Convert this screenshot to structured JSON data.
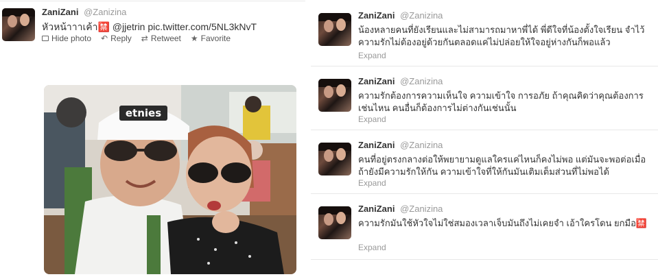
{
  "left_tweet": {
    "name": "ZaniZani",
    "handle": "@Zanizina",
    "text": "หัวหน้าาาเค้า🈲 @jjetrin pic.twitter.com/5NL3kNvT",
    "actions": {
      "hide_photo": "Hide photo",
      "reply": "Reply",
      "retweet": "Retweet",
      "favorite": "Favorite"
    },
    "photo": {
      "cap_text": "etnies"
    }
  },
  "right_tweets": [
    {
      "name": "ZaniZani",
      "handle": "@Zanizina",
      "text": "น้องหลายคนที่ยังเรียนและไม่สามารถมาหาพี่ได้ พี่ดีใจที่น้องตั้งใจเรียน จำไว้ความรักไม่ต้องอยู่ด้วยกันตลอดแค่ไม่ปล่อยให้ใจอยู่ห่างกันก็พอแล้ว",
      "expand": "Expand"
    },
    {
      "name": "ZaniZani",
      "handle": "@Zanizina",
      "text": "ความรักต้องการความเห็นใจ ความเข้าใจ การอภัย ถ้าคุณคิดว่าคุณต้องการเช่นไหน คนอื่นก็ต้องการไม่ต่างกันเช่นนั้น",
      "expand": "Expand"
    },
    {
      "name": "ZaniZani",
      "handle": "@Zanizina",
      "text": "คนที่อยู่ตรงกลางต่อให้พยายามดูแลใครแค่ไหนก็คงไม่พอ แต่มันจะพอต่อเมื่อถ้ายังมีความรักให้กัน ความเข้าใจที่ให้กันมันเติมเต็มส่วนที่ไม่พอได้",
      "expand": "Expand"
    },
    {
      "name": "ZaniZani",
      "handle": "@Zanizina",
      "text": "ความรักมันใช้หัวใจไม่ใช่สมองเวลาเจ็บมันถึงไม่เคยจำ เอ้าใครโดน ยกมือ🈲",
      "expand": "Expand"
    }
  ]
}
